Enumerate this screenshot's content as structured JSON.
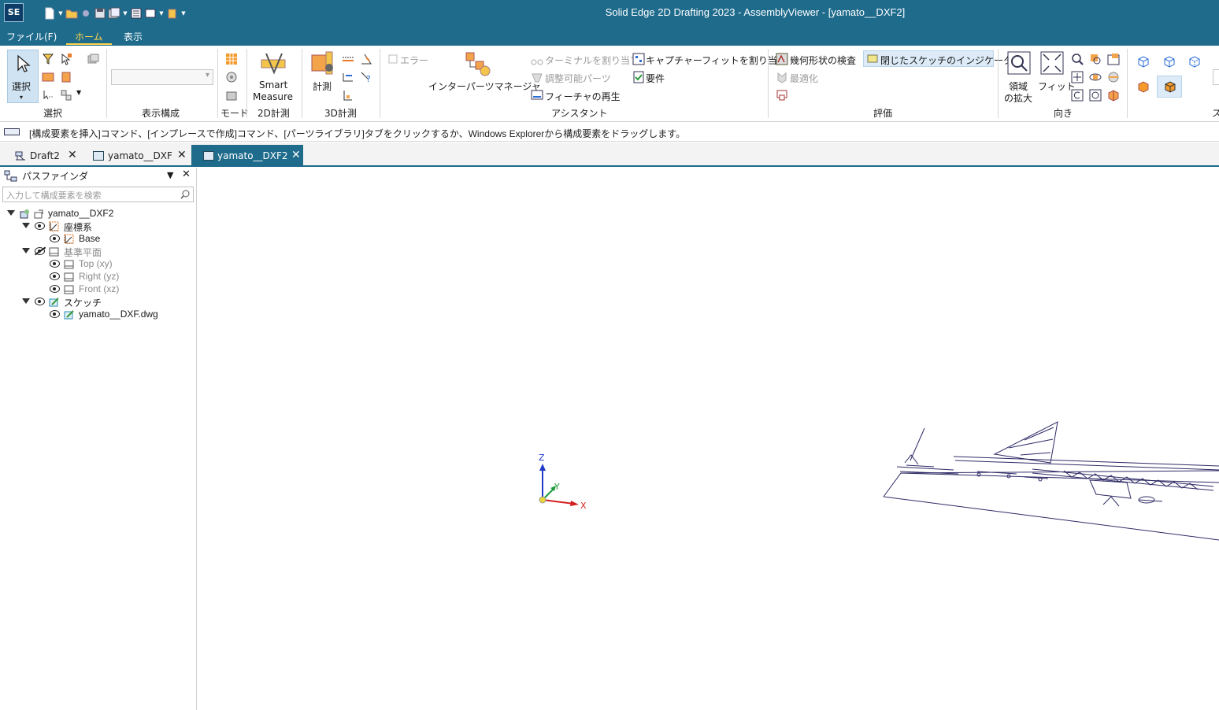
{
  "window": {
    "title": "Solid Edge 2D Drafting 2023 - AssemblyViewer - [yamato__DXF2]",
    "app_icon": "SE"
  },
  "quick_access": [
    "new-icon",
    "open-icon",
    "sync-icon",
    "save-icon",
    "save-as-icon",
    "document-icon",
    "view-icon",
    "settings-icon",
    "more-icon"
  ],
  "menu": {
    "file": "ファイル(F)",
    "home": "ホーム",
    "view": "表示"
  },
  "ribbon": {
    "select": {
      "group": "選択",
      "select_btn": "選択"
    },
    "display_config": {
      "group": "表示構成",
      "combo_value": ""
    },
    "mode": {
      "group": "モード"
    },
    "measure2d": {
      "group": "2D計測",
      "smart_measure_1": "Smart",
      "smart_measure_2": "Measure"
    },
    "measure3d": {
      "group": "3D計測",
      "measure": "計測"
    },
    "assistant": {
      "group": "アシスタント",
      "error": "エラー",
      "interparts_manager": "インターパーツマネージャ",
      "assign_terminal": "ターミナルを割り当て",
      "adjustable_parts": "調整可能パーツ",
      "feature_playback": "フィーチャの再生",
      "capture_fit": "キャプチャーフィットを割り当て",
      "requirements": "要件"
    },
    "evaluate": {
      "group": "評価",
      "geometry_check": "幾何形状の検査",
      "closed_sketch": "閉じたスケッチのインジケータ",
      "optimize": "最適化"
    },
    "orient": {
      "group": "向き",
      "zoom_area_1": "領域",
      "zoom_area_2": "の拡大",
      "fit": "フィット"
    },
    "style": {
      "group": "ス"
    }
  },
  "prompt": "[構成要素を挿入]コマンド、[インプレースで作成]コマンド、[パーツライブラリ]タブをクリックするか、Windows Explorerから構成要素をドラッグします。",
  "doc_tabs": [
    {
      "label": "Draft2"
    },
    {
      "label": "yamato__DXF"
    },
    {
      "label": "yamato__DXF2"
    }
  ],
  "pathfinder": {
    "title": "パスファインダ",
    "search_placeholder": "入力して構成要素を検索",
    "tree": {
      "root": "yamato__DXF2",
      "coord_systems": "座標系",
      "base": "Base",
      "ref_planes": "基準平面",
      "top": "Top (xy)",
      "right": "Right (yz)",
      "front": "Front (xz)",
      "sketches": "スケッチ",
      "sketch_file": "yamato__DXF.dwg"
    }
  },
  "triad": {
    "z": "Z",
    "y": "Y",
    "x": "X"
  },
  "colors": {
    "titlebar": "#1e6b8c",
    "accent": "#ffd54a",
    "wire": "#2e2a66"
  }
}
